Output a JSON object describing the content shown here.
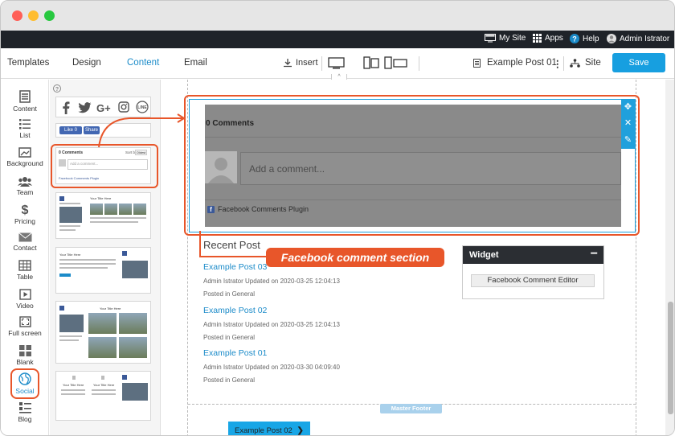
{
  "topbar": {
    "my_site": "My Site",
    "apps": "Apps",
    "help": "Help",
    "user": "Admin Istrator"
  },
  "toolbar": {
    "tabs": [
      "Templates",
      "Design",
      "Content",
      "Email"
    ],
    "active_tab": "Content",
    "insert": "Insert",
    "page_name": "Example Post 01",
    "site": "Site",
    "save": "Save"
  },
  "sidebar": {
    "items": [
      {
        "label": "Content",
        "icon": "content-icon"
      },
      {
        "label": "List",
        "icon": "list-icon"
      },
      {
        "label": "Background",
        "icon": "background-icon"
      },
      {
        "label": "Team",
        "icon": "team-icon"
      },
      {
        "label": "Pricing",
        "icon": "dollar-icon"
      },
      {
        "label": "Contact",
        "icon": "mail-icon"
      },
      {
        "label": "Table",
        "icon": "table-icon"
      },
      {
        "label": "Video",
        "icon": "video-icon"
      },
      {
        "label": "Full screen",
        "icon": "fullscreen-icon"
      },
      {
        "label": "Blank",
        "icon": "blank-icon"
      },
      {
        "label": "Social",
        "icon": "globe-icon"
      },
      {
        "label": "Blog",
        "icon": "blog-icon"
      }
    ],
    "highlighted": "Social"
  },
  "panel": {
    "help": "?",
    "like_button": "Like 0",
    "share_button": "Share",
    "thumb_comments_title": "0 Comments",
    "thumb_comments_sort": "Sort by",
    "thumb_comments_sort_value": "Oldest",
    "thumb_comments_placeholder": "Add a comment...",
    "thumb_comments_plugin": "Facebook Comments Plugin",
    "thumb_video_title": "Your Title Here",
    "thumb_wide_title": "Your Title Here",
    "thumb_gallery_title": "Your Title Here",
    "thumb_two_col_left": "Your Title Here",
    "thumb_two_col_mid": "Your Title Here"
  },
  "fb_comments": {
    "count": "0 Comments",
    "placeholder": "Add a comment...",
    "plugin": "Facebook Comments Plugin"
  },
  "callout": {
    "label": "Facebook comment section"
  },
  "recent_post": {
    "title": "Recent Post",
    "posts": [
      {
        "title": "Example Post 03",
        "meta": "Admin Istrator Updated on 2020-03-25 12:04:13",
        "category": "Posted in General"
      },
      {
        "title": "Example Post 02",
        "meta": "Admin Istrator Updated on 2020-03-25 12:04:13",
        "category": "Posted in General"
      },
      {
        "title": "Example Post 01",
        "meta": "Admin Istrator Updated on 2020-03-30 04:09:40",
        "category": "Posted in General"
      }
    ]
  },
  "widget": {
    "title": "Widget",
    "minimize": "−",
    "button": "Facebook Comment Editor"
  },
  "footer": {
    "master_label": "Master Footer",
    "button": "Example Post 02",
    "button_arrow": "❯"
  },
  "colors": {
    "accent": "#1b8bc9",
    "save": "#179fe0",
    "highlight": "#e8562a",
    "dark_bar": "#1f2329",
    "facebook": "#3b5998"
  }
}
